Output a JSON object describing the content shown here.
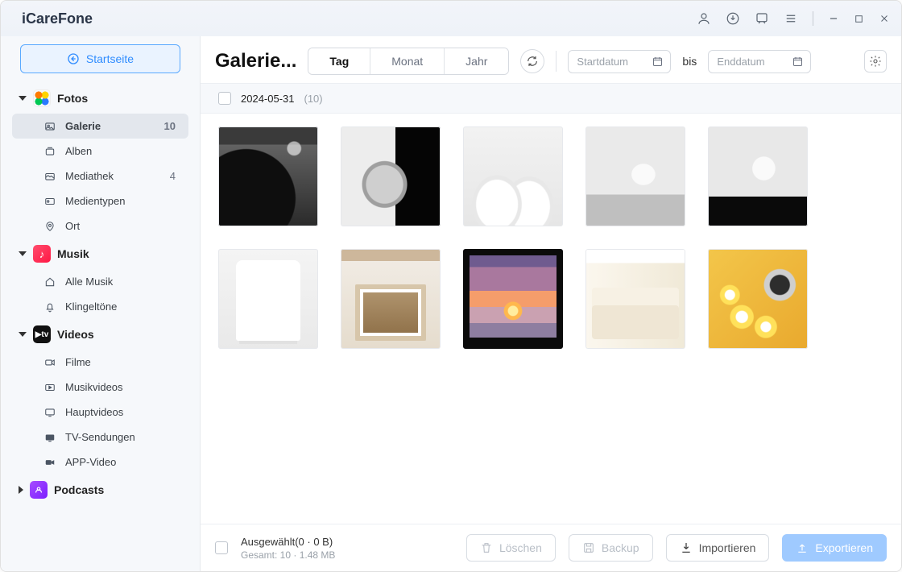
{
  "app_name": "iCareFone",
  "home_button": "Startseite",
  "sections": {
    "fotos": {
      "label": "Fotos",
      "items": [
        {
          "label": "Galerie",
          "count": "10",
          "active": true
        },
        {
          "label": "Alben"
        },
        {
          "label": "Mediathek",
          "count": "4"
        },
        {
          "label": "Medientypen"
        },
        {
          "label": "Ort"
        }
      ]
    },
    "musik": {
      "label": "Musik",
      "items": [
        {
          "label": "Alle Musik"
        },
        {
          "label": "Klingeltöne"
        }
      ]
    },
    "videos": {
      "label": "Videos",
      "items": [
        {
          "label": "Filme"
        },
        {
          "label": "Musikvideos"
        },
        {
          "label": "Hauptvideos"
        },
        {
          "label": "TV-Sendungen"
        },
        {
          "label": "APP-Video"
        }
      ]
    },
    "podcasts": {
      "label": "Podcasts"
    }
  },
  "page": {
    "title": "Galerie...",
    "segments": {
      "day": "Tag",
      "month": "Monat",
      "year": "Jahr"
    },
    "start_placeholder": "Startdatum",
    "range_label": "bis",
    "end_placeholder": "Enddatum"
  },
  "group": {
    "date": "2024-05-31",
    "count": "(10)"
  },
  "footer": {
    "selected": "Ausgewählt(0 · 0 B)",
    "total": "Gesamt: 10 · 1.48 MB",
    "delete": "Löschen",
    "backup": "Backup",
    "import": "Importieren",
    "export": "Exportieren"
  }
}
